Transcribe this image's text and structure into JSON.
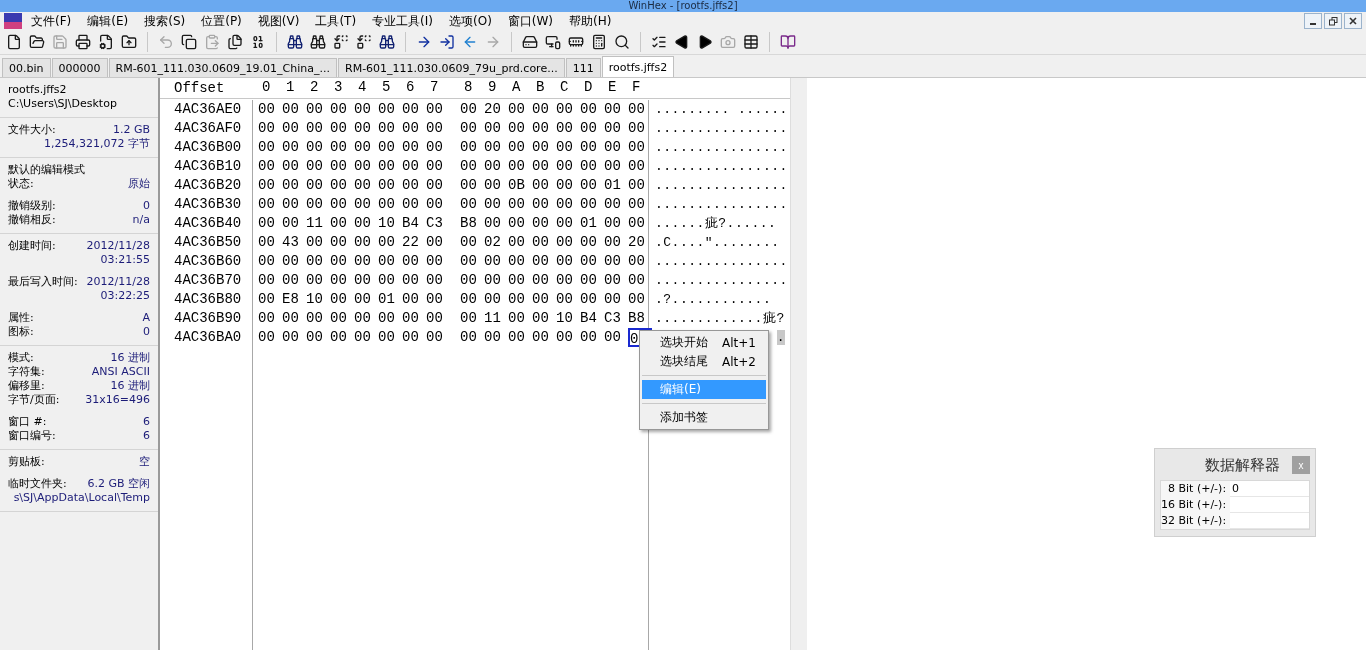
{
  "window": {
    "title": "WinHex - [rootfs.jffs2]"
  },
  "menu": [
    "文件(F)",
    "编辑(E)",
    "搜索(S)",
    "位置(P)",
    "视图(V)",
    "工具(T)",
    "专业工具(I)",
    "选项(O)",
    "窗口(W)",
    "帮助(H)"
  ],
  "toolbar": [
    [
      {
        "kind": "new",
        "disabled": false
      },
      {
        "kind": "open",
        "disabled": false
      },
      {
        "kind": "save",
        "disabled": true
      },
      {
        "kind": "print",
        "disabled": false
      },
      {
        "kind": "properties",
        "disabled": false
      },
      {
        "kind": "export",
        "disabled": false
      }
    ],
    [
      {
        "kind": "undo",
        "disabled": true
      },
      {
        "kind": "copy",
        "disabled": false
      },
      {
        "kind": "paste",
        "disabled": true
      },
      {
        "kind": "paste-file",
        "disabled": false
      },
      {
        "kind": "binary",
        "disabled": false
      }
    ],
    [
      {
        "kind": "find",
        "disabled": false
      },
      {
        "kind": "find-hex",
        "disabled": false
      },
      {
        "kind": "replace",
        "disabled": false
      },
      {
        "kind": "replace-hex",
        "disabled": false
      },
      {
        "kind": "find-next",
        "disabled": false
      }
    ],
    [
      {
        "kind": "goto",
        "disabled": false
      },
      {
        "kind": "jump",
        "disabled": false
      },
      {
        "kind": "back",
        "disabled": false
      },
      {
        "kind": "forward",
        "disabled": true
      }
    ],
    [
      {
        "kind": "disk",
        "disabled": false
      },
      {
        "kind": "network",
        "disabled": false
      },
      {
        "kind": "ram",
        "disabled": false
      },
      {
        "kind": "calculator",
        "disabled": false
      },
      {
        "kind": "search",
        "disabled": false
      }
    ],
    [
      {
        "kind": "check",
        "disabled": false
      },
      {
        "kind": "prev",
        "disabled": false
      },
      {
        "kind": "next",
        "disabled": false
      },
      {
        "kind": "camera",
        "disabled": true
      },
      {
        "kind": "table",
        "disabled": false
      }
    ],
    [
      {
        "kind": "help",
        "disabled": false
      }
    ]
  ],
  "tabs": [
    {
      "label": "00.bin",
      "selected": false
    },
    {
      "label": "000000",
      "selected": false
    },
    {
      "label": "RM-601_111.030.0609_19.01_China_...",
      "selected": false
    },
    {
      "label": "RM-601_111.030.0609_79u_prd.core...",
      "selected": false
    },
    {
      "label": "111",
      "selected": false
    },
    {
      "label": "rootfs.jffs2",
      "selected": true
    }
  ],
  "info_panel": {
    "file_name": "rootfs.jffs2",
    "path": "C:\\Users\\SJ\\Desktop",
    "sections": [
      [
        [
          {
            "label": "文件大小:",
            "value": "1.2 GB"
          },
          {
            "value": "1,254,321,072 字节"
          }
        ]
      ],
      [
        [
          {
            "label": "默认的编辑模式"
          },
          {
            "label": "状态:",
            "value": "原始"
          }
        ],
        [
          {
            "label": "撤销级别:",
            "value": "0"
          },
          {
            "label": "撤销相反:",
            "value": "n/a"
          }
        ]
      ],
      [
        [
          {
            "label": "创建时间:",
            "value": "2012/11/28"
          },
          {
            "value": "03:21:55"
          }
        ],
        [
          {
            "label": "最后写入时间:",
            "value": "2012/11/28"
          },
          {
            "value": "03:22:25"
          }
        ],
        [
          {
            "label": "属性:",
            "value": "A"
          },
          {
            "label": "图标:",
            "value": "0"
          }
        ]
      ],
      [
        [
          {
            "label": "模式:",
            "value": "16 进制"
          },
          {
            "label": "字符集:",
            "value": "ANSI ASCII"
          },
          {
            "label": "偏移里:",
            "value": "16 进制"
          },
          {
            "label": "字节/页面:",
            "value": "31x16=496"
          }
        ],
        [
          {
            "label": "窗口 #:",
            "value": "6"
          },
          {
            "label": "窗口编号:",
            "value": "6"
          }
        ]
      ],
      [
        [
          {
            "label": "剪贴板:",
            "value": "空"
          }
        ],
        [
          {
            "label": "临时文件夹:",
            "value": "6.2 GB 空闲"
          },
          {
            "value": "s\\SJ\\AppData\\Local\\Temp"
          }
        ]
      ]
    ]
  },
  "hex": {
    "offset_header": "Offset",
    "columns": [
      "0",
      "1",
      "2",
      "3",
      "4",
      "5",
      "6",
      "7",
      "8",
      "9",
      "A",
      "B",
      "C",
      "D",
      "E",
      "F"
    ],
    "rows": [
      {
        "offset": "4AC36AE0",
        "bytes": [
          "00",
          "00",
          "00",
          "00",
          "00",
          "00",
          "00",
          "00",
          "00",
          "20",
          "00",
          "00",
          "00",
          "00",
          "00",
          "00"
        ],
        "text": "......... ......",
        "cursor_at_end": false
      },
      {
        "offset": "4AC36AF0",
        "bytes": [
          "00",
          "00",
          "00",
          "00",
          "00",
          "00",
          "00",
          "00",
          "00",
          "00",
          "00",
          "00",
          "00",
          "00",
          "00",
          "00"
        ],
        "text": "................",
        "cursor_at_end": false
      },
      {
        "offset": "4AC36B00",
        "bytes": [
          "00",
          "00",
          "00",
          "00",
          "00",
          "00",
          "00",
          "00",
          "00",
          "00",
          "00",
          "00",
          "00",
          "00",
          "00",
          "00"
        ],
        "text": "................",
        "cursor_at_end": false
      },
      {
        "offset": "4AC36B10",
        "bytes": [
          "00",
          "00",
          "00",
          "00",
          "00",
          "00",
          "00",
          "00",
          "00",
          "00",
          "00",
          "00",
          "00",
          "00",
          "00",
          "00"
        ],
        "text": "................",
        "cursor_at_end": false
      },
      {
        "offset": "4AC36B20",
        "bytes": [
          "00",
          "00",
          "00",
          "00",
          "00",
          "00",
          "00",
          "00",
          "00",
          "00",
          "0B",
          "00",
          "00",
          "00",
          "01",
          "00"
        ],
        "text": "................",
        "cursor_at_end": false
      },
      {
        "offset": "4AC36B30",
        "bytes": [
          "00",
          "00",
          "00",
          "00",
          "00",
          "00",
          "00",
          "00",
          "00",
          "00",
          "00",
          "00",
          "00",
          "00",
          "00",
          "00"
        ],
        "text": "................",
        "cursor_at_end": false
      },
      {
        "offset": "4AC36B40",
        "bytes": [
          "00",
          "00",
          "11",
          "00",
          "00",
          "10",
          "B4",
          "C3",
          "B8",
          "00",
          "00",
          "00",
          "00",
          "01",
          "00",
          "00"
        ],
        "text": "......疵?......",
        "cursor_at_end": false
      },
      {
        "offset": "4AC36B50",
        "bytes": [
          "00",
          "43",
          "00",
          "00",
          "00",
          "00",
          "22",
          "00",
          "00",
          "02",
          "00",
          "00",
          "00",
          "00",
          "00",
          "20"
        ],
        "text": ".C....″........",
        "cursor_at_end": false
      },
      {
        "offset": "4AC36B60",
        "bytes": [
          "00",
          "00",
          "00",
          "00",
          "00",
          "00",
          "00",
          "00",
          "00",
          "00",
          "00",
          "00",
          "00",
          "00",
          "00",
          "00"
        ],
        "text": "................",
        "cursor_at_end": false
      },
      {
        "offset": "4AC36B70",
        "bytes": [
          "00",
          "00",
          "00",
          "00",
          "00",
          "00",
          "00",
          "00",
          "00",
          "00",
          "00",
          "00",
          "00",
          "00",
          "00",
          "00"
        ],
        "text": "................",
        "cursor_at_end": false
      },
      {
        "offset": "4AC36B80",
        "bytes": [
          "00",
          "E8",
          "10",
          "00",
          "00",
          "01",
          "00",
          "00",
          "00",
          "00",
          "00",
          "00",
          "00",
          "00",
          "00",
          "00"
        ],
        "text": ".?............",
        "cursor_at_end": false
      },
      {
        "offset": "4AC36B90",
        "bytes": [
          "00",
          "00",
          "00",
          "00",
          "00",
          "00",
          "00",
          "00",
          "00",
          "11",
          "00",
          "00",
          "10",
          "B4",
          "C3",
          "B8"
        ],
        "text": ".............疵?",
        "cursor_at_end": false
      },
      {
        "offset": "4AC36BA0",
        "bytes": [
          "00",
          "00",
          "00",
          "00",
          "00",
          "00",
          "00",
          "00",
          "00",
          "00",
          "00",
          "00",
          "00",
          "00",
          "00",
          "0"
        ],
        "text": ".",
        "cursor_at_end": true
      }
    ]
  },
  "context_menu": [
    [
      {
        "label": "选块开始",
        "shortcut": "Alt+1",
        "selected": false
      },
      {
        "label": "选块结尾",
        "shortcut": "Alt+2",
        "selected": false
      }
    ],
    [
      {
        "label": "编辑(E)",
        "selected": true
      }
    ],
    [
      {
        "label": "添加书签",
        "selected": false
      }
    ]
  ],
  "interpreter": {
    "title": "数据解释器",
    "close": "x",
    "rows": [
      {
        "label": "8 Bit (+/-):",
        "value": "0"
      },
      {
        "label": "16 Bit (+/-):"
      },
      {
        "label": "32 Bit (+/-):"
      }
    ]
  }
}
